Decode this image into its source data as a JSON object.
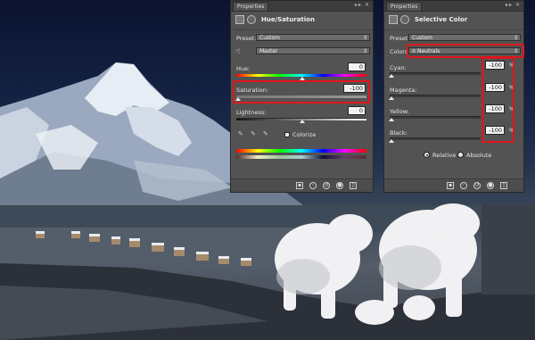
{
  "hue_panel": {
    "tab_title": "Properties",
    "header_title": "Hue/Saturation",
    "preset_label": "Preset:",
    "preset_value": "Custom",
    "channel_value": "Master",
    "hue_label": "Hue:",
    "hue_value": "0",
    "saturation_label": "Saturation:",
    "saturation_value": "-100",
    "lightness_label": "Lightness:",
    "lightness_value": "0",
    "colorize_label": "Colorize"
  },
  "selective_panel": {
    "tab_title": "Properties",
    "header_title": "Selective Color",
    "preset_label": "Preset:",
    "preset_value": "Custom",
    "colors_label": "Colors:",
    "colors_value": "Neutrals",
    "cyan_label": "Cyan:",
    "cyan_value": "-100",
    "magenta_label": "Magenta:",
    "magenta_value": "-100",
    "yellow_label": "Yellow:",
    "yellow_value": "-100",
    "black_label": "Black:",
    "black_value": "-100",
    "percent": "%",
    "relative_label": "Relative",
    "absolute_label": "Absolute"
  },
  "icons": {
    "footer": [
      "clip-to-layer-icon",
      "view-previous-icon",
      "reset-icon",
      "visibility-eye-icon",
      "trash-icon"
    ],
    "eyedroppers": [
      "eyedropper-icon",
      "eyedropper-plus-icon",
      "eyedropper-minus-icon"
    ]
  },
  "colors": {
    "panel_bg": "#535353",
    "highlight": "#e0151b"
  }
}
